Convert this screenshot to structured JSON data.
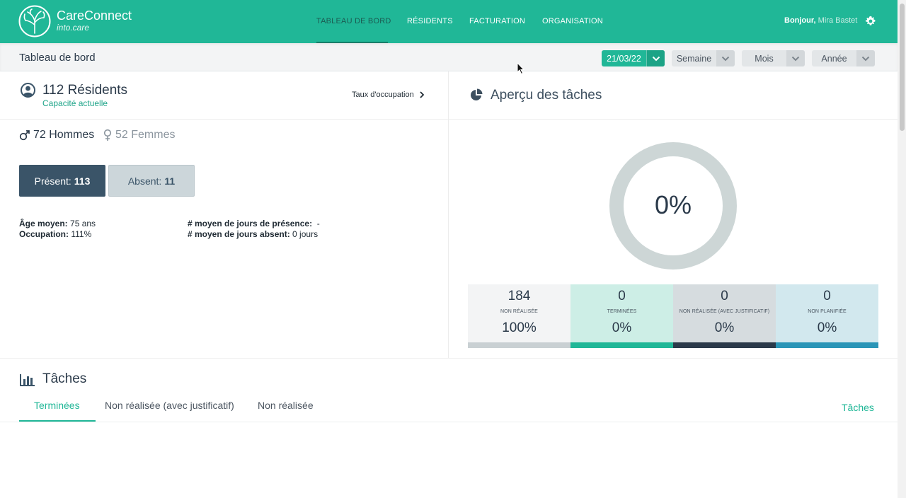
{
  "app": {
    "brand_name": "CareConnect",
    "brand_sub": "into.care",
    "accent_color": "#20b797"
  },
  "nav": {
    "items": [
      {
        "label": "TABLEAU DE BORD",
        "active": true
      },
      {
        "label": "RÉSIDENTS",
        "active": false
      },
      {
        "label": "FACTURATION",
        "active": false
      },
      {
        "label": "ORGANISATION",
        "active": false
      }
    ],
    "greeting": "Bonjour,",
    "user": "Mira Bastet",
    "settings_icon": "gear-icon"
  },
  "subheader": {
    "title": "Tableau de bord",
    "date": "21/03/22",
    "week": "Semaine",
    "month": "Mois",
    "year": "Année"
  },
  "residents": {
    "count_label": "112 Résidents",
    "capacity_label": "Capacité actuelle",
    "occupancy_link": "Taux d'occupation",
    "men": "72 Hommes",
    "women": "52 Femmes",
    "present_label": "Présent:",
    "present_value": "113",
    "absent_label": "Absent:",
    "absent_value": "11",
    "avg_age_label": "Âge moyen:",
    "avg_age_value": "75 ans",
    "occupation_label": "Occupation:",
    "occupation_value": "111%",
    "avg_presence_label": "# moyen de jours de présence:",
    "avg_presence_value": "-",
    "avg_absence_label": "# moyen de jours absent:",
    "avg_absence_value": "0 jours"
  },
  "overview": {
    "title": "Aperçu des tâches",
    "donut_value": "0%",
    "donut_fraction": 0,
    "tiles": [
      {
        "num": "184",
        "label": "NON RÉALISÉE",
        "pct": "100%",
        "bg": "#f3f4f5",
        "bar": "#c9d0d3"
      },
      {
        "num": "0",
        "label": "TERMINÉES",
        "pct": "0%",
        "bg": "#cdeee6",
        "bar": "#20b797"
      },
      {
        "num": "0",
        "label": "NON RÉALISÉE (AVEC JUSTIFICATIF)",
        "pct": "0%",
        "bg": "#d6dcdf",
        "bar": "#2b3a4a"
      },
      {
        "num": "0",
        "label": "NON PLANIFIÉE",
        "pct": "0%",
        "bg": "#d2e8ee",
        "bar": "#2a95b7"
      }
    ]
  },
  "tasks": {
    "title": "Tâches",
    "tabs": [
      "Terminées",
      "Non réalisée (avec justificatif)",
      "Non réalisée"
    ],
    "active_tab": "Terminées",
    "link": "Tâches"
  }
}
